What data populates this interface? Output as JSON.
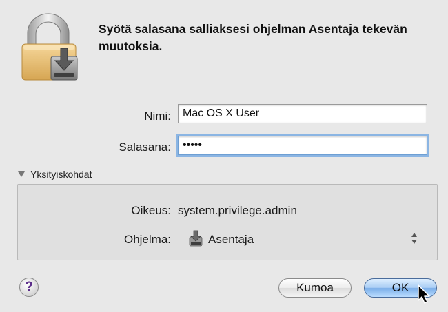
{
  "dialog": {
    "message": "Syötä salasana salliaksesi ohjelman Asentaja tekevän muutoksia."
  },
  "form": {
    "name_label": "Nimi:",
    "name_value": "Mac OS X User",
    "password_label": "Salasana:",
    "password_value": "•••••"
  },
  "details": {
    "toggle_label": "Yksityiskohdat",
    "right_label": "Oikeus:",
    "right_value": "system.privilege.admin",
    "program_label": "Ohjelma:",
    "program_value": "Asentaja"
  },
  "buttons": {
    "help_label": "?",
    "cancel_label": "Kumoa",
    "ok_label": "OK"
  },
  "icons": {
    "lock": "lock-icon",
    "installer": "installer-icon",
    "popup_arrows": "popup-arrows-icon",
    "cursor": "mouse-cursor-icon"
  },
  "colors": {
    "background": "#e8e8e8",
    "focus_ring": "#8bb5e3",
    "default_button": "#7aaee8",
    "help_glyph": "#5b2d8a"
  }
}
